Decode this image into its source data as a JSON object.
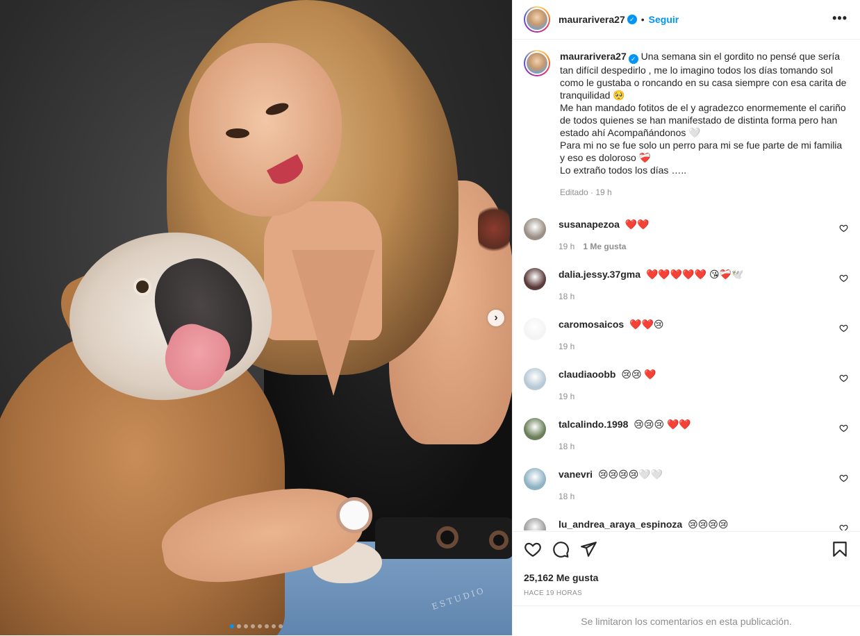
{
  "header": {
    "username": "maurarivera27",
    "verified_symbol": "✓",
    "separator": "•",
    "follow_label": "Seguir",
    "more_label": "•••"
  },
  "caption": {
    "username": "maurarivera27",
    "text": "Una semana sin el gordito no pensé que sería tan difícil despedirlo , me lo imagino todos los días tomando sol como le gustaba o roncando en su casa siempre con esa carita de tranquilidad 🥺",
    "line2": "Me han mandado fotitos de el y agradezco enormemente el cariño de todos quienes se han manifestado de distinta forma pero han estado ahí Acompañándonos 🤍",
    "line3": "Para mi no se fue solo un perro para mi se fue parte de mi familia y eso es doloroso ❤️‍🩹",
    "line4": "Lo extraño todos los días …..",
    "meta": "Editado · 19 h"
  },
  "comments": [
    {
      "username": "susanapezoa",
      "text": "❤️❤️",
      "time": "19 h",
      "likes": "1 Me gusta",
      "avatar_color": "#9a8f86"
    },
    {
      "username": "dalia.jessy.37gma",
      "text": "❤️❤️❤️❤️❤️ 😘❤️‍🩹🕊️",
      "time": "18 h",
      "likes": "",
      "avatar_color": "#5b3a3a"
    },
    {
      "username": "caromosaicos",
      "text": "❤️❤️😢",
      "time": "19 h",
      "likes": "",
      "avatar_color": "#f4f4f4"
    },
    {
      "username": "claudiaoobb",
      "text": "😢😢 ❤️",
      "time": "19 h",
      "likes": "",
      "avatar_color": "#b7c9d6"
    },
    {
      "username": "talcalindo.1998",
      "text": "😢😢😢 ❤️❤️",
      "time": "18 h",
      "likes": "",
      "avatar_color": "#6b7f5a"
    },
    {
      "username": "vanevri",
      "text": "😢😢😢😢🤍🤍",
      "time": "18 h",
      "likes": "",
      "avatar_color": "#8fb3c4"
    },
    {
      "username": "lu_andrea_araya_espinoza",
      "text": "😢😢😢😢",
      "time": "",
      "likes": "",
      "avatar_color": "#9f9f9f"
    }
  ],
  "footer": {
    "likes": "25,162 Me gusta",
    "time_ago": "HACE 19 HORAS",
    "limited": "Se limitaron los comentarios en esta publicación."
  },
  "media": {
    "next_label": "›",
    "watermark": "ESTUDIO",
    "carousel_count": 8,
    "carousel_active": 0
  },
  "icons": [
    "like-icon",
    "comment-icon",
    "share-icon",
    "save-icon",
    "more-icon",
    "verified-icon",
    "next-arrow-icon",
    "comment-like-icon"
  ],
  "colors": {
    "accent": "#0095f6",
    "text": "#262626",
    "muted": "#8e8e8e",
    "border": "#efefef"
  }
}
